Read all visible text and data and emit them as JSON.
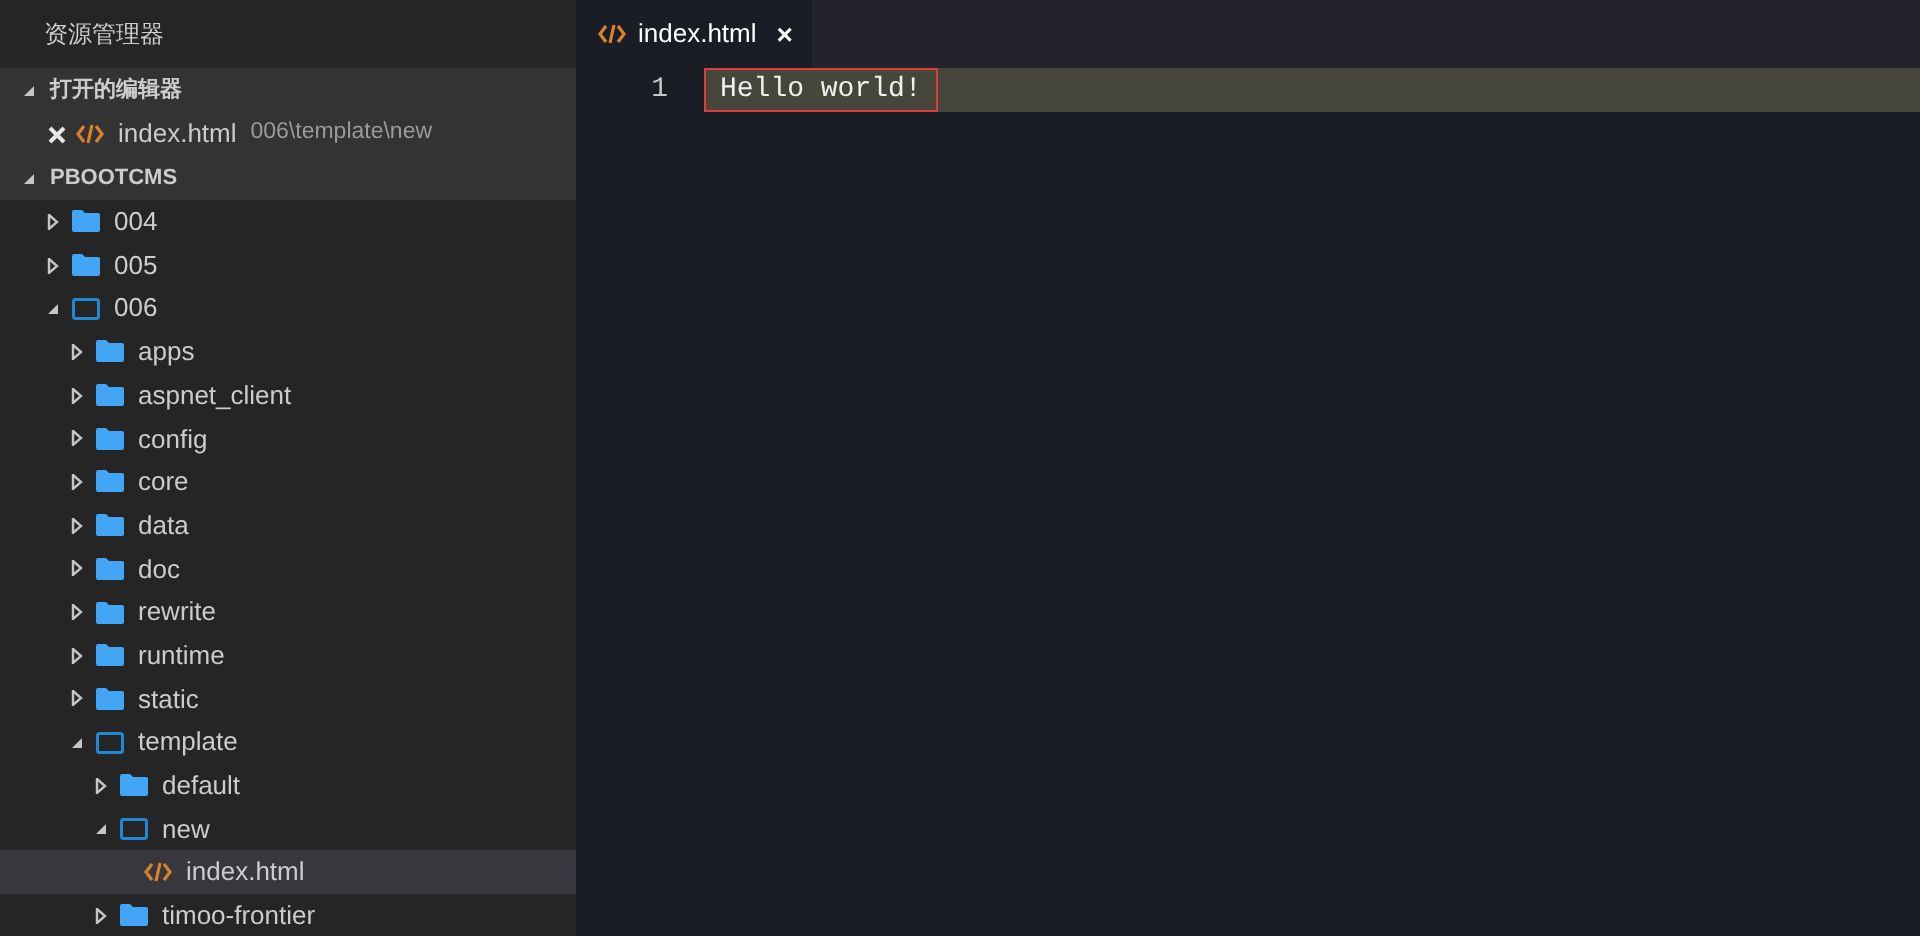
{
  "sidebar": {
    "title": "资源管理器",
    "sections": [
      {
        "title": "打开的编辑器",
        "expanded": true,
        "open_editors": [
          {
            "name": "index.html",
            "path": "006\\template\\new"
          }
        ]
      },
      {
        "title": "PBOOTCMS",
        "expanded": true,
        "tree": [
          {
            "kind": "folder",
            "name": "004",
            "expanded": false,
            "selected": false
          },
          {
            "kind": "folder",
            "name": "005",
            "expanded": false,
            "selected": false
          },
          {
            "kind": "folder",
            "name": "006",
            "expanded": true,
            "selected": false,
            "children": [
              {
                "kind": "folder",
                "name": "apps",
                "expanded": false,
                "selected": false
              },
              {
                "kind": "folder",
                "name": "aspnet_client",
                "expanded": false,
                "selected": false
              },
              {
                "kind": "folder",
                "name": "config",
                "expanded": false,
                "selected": false
              },
              {
                "kind": "folder",
                "name": "core",
                "expanded": false,
                "selected": false
              },
              {
                "kind": "folder",
                "name": "data",
                "expanded": false,
                "selected": false
              },
              {
                "kind": "folder",
                "name": "doc",
                "expanded": false,
                "selected": false
              },
              {
                "kind": "folder",
                "name": "rewrite",
                "expanded": false,
                "selected": false
              },
              {
                "kind": "folder",
                "name": "runtime",
                "expanded": false,
                "selected": false
              },
              {
                "kind": "folder",
                "name": "static",
                "expanded": false,
                "selected": false
              },
              {
                "kind": "folder",
                "name": "template",
                "expanded": true,
                "selected": false,
                "children": [
                  {
                    "kind": "folder",
                    "name": "default",
                    "expanded": false,
                    "selected": false
                  },
                  {
                    "kind": "folder",
                    "name": "new",
                    "expanded": true,
                    "selected": false,
                    "children": [
                      {
                        "kind": "file",
                        "name": "index.html",
                        "selected": true
                      }
                    ]
                  },
                  {
                    "kind": "folder",
                    "name": "timoo-frontier",
                    "expanded": false,
                    "selected": false
                  }
                ]
              }
            ]
          }
        ]
      }
    ]
  },
  "editor": {
    "tabs": [
      {
        "label": "index.html",
        "selected": true,
        "close": "×"
      }
    ],
    "lines": [
      {
        "number": "1",
        "text": "Hello world!",
        "current": true
      }
    ]
  }
}
